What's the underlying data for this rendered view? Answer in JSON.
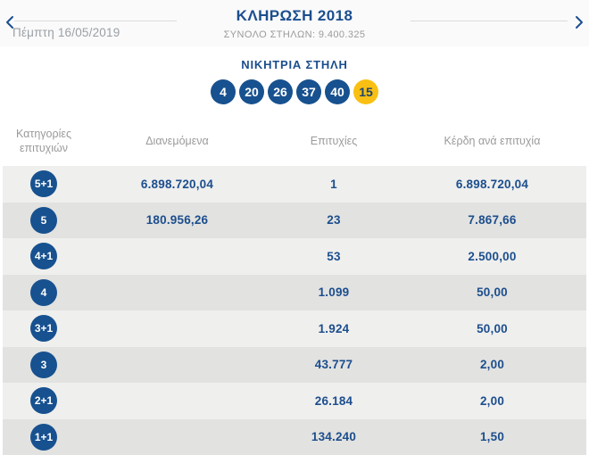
{
  "nav": {
    "date": "Πέμπτη 16/05/2019",
    "title": "ΚΛΗΡΩΣΗ 2018",
    "subtitle": "ΣΥΝΟΛΟ ΣΤΗΛΩΝ: 9.400.325"
  },
  "winning": {
    "heading": "ΝΙΚΗΤΡΙΑ ΣΤΗΛΗ",
    "numbers": [
      {
        "value": "4",
        "color": "blue"
      },
      {
        "value": "20",
        "color": "blue"
      },
      {
        "value": "26",
        "color": "blue"
      },
      {
        "value": "37",
        "color": "blue"
      },
      {
        "value": "40",
        "color": "blue"
      },
      {
        "value": "15",
        "color": "yellow"
      }
    ]
  },
  "table": {
    "headers": {
      "category": "Κατηγορίες επιτυχιών",
      "distributed": "Διανεμόμενα",
      "winners": "Επιτυχίες",
      "prize": "Κέρδη ανά επιτυχία"
    },
    "rows": [
      {
        "category": "5+1",
        "distributed": "6.898.720,04",
        "winners": "1",
        "prize": "6.898.720,04"
      },
      {
        "category": "5",
        "distributed": "180.956,26",
        "winners": "23",
        "prize": "7.867,66"
      },
      {
        "category": "4+1",
        "distributed": "",
        "winners": "53",
        "prize": "2.500,00"
      },
      {
        "category": "4",
        "distributed": "",
        "winners": "1.099",
        "prize": "50,00"
      },
      {
        "category": "3+1",
        "distributed": "",
        "winners": "1.924",
        "prize": "50,00"
      },
      {
        "category": "3",
        "distributed": "",
        "winners": "43.777",
        "prize": "2,00"
      },
      {
        "category": "2+1",
        "distributed": "",
        "winners": "26.184",
        "prize": "2,00"
      },
      {
        "category": "1+1",
        "distributed": "",
        "winners": "134.240",
        "prize": "1,50"
      }
    ]
  },
  "colors": {
    "accent_blue": "#1b4e8e",
    "ball_blue": "#17518f",
    "ball_yellow": "#f9c013",
    "row_light": "#efefee",
    "row_dark": "#e2e2e0",
    "muted_gray": "#9b9b9b"
  }
}
